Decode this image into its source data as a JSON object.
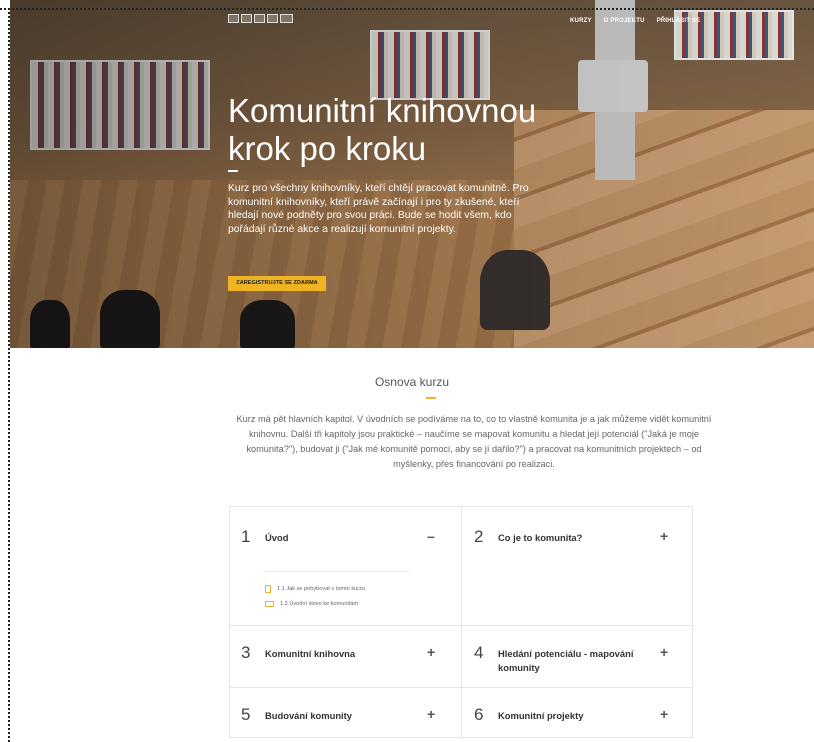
{
  "nav": {
    "items": [
      {
        "label": "KURZY"
      },
      {
        "label": "O PROJEKTU"
      },
      {
        "label": "PŘIHLÁSIT SE"
      }
    ]
  },
  "hero": {
    "title": "Komunitní knihovnou krok po kroku",
    "text": "Kurz pro všechny knihovníky, kteří chtějí pracovat komunitně. Pro komunitní knihovníky, kteří právě začínají i pro ty zkušené, kteří hledají nové podněty pro svou práci. Bude se hodit všem, kdo pořádají různé akce a realizují komunitní projekty.",
    "cta_label": "ZAREGISTRUJTE SE ZDARMA"
  },
  "section": {
    "title": "Osnova kurzu",
    "description": "Kurz má pět hlavních kapitol. V úvodních se podíváme na to, co to vlastně komunita je a jak můžeme vidět komunitní knihovnu. Další tři kapitoly jsou praktické – naučíme se mapovat komunitu a hledat její potenciál (\"Jaká je moje komunita?\"), budovat ji (\"Jak mé komunitě pomoci, aby se jí dařilo?\") a pracovat na komunitních projektech – od myšlenky, přes financování po realizaci."
  },
  "modules": [
    {
      "number": "1",
      "title": "Úvod",
      "toggle": "–",
      "expanded": true,
      "lessons": [
        {
          "icon": "document-icon",
          "label": "1.1 Jak se pohybovat v tomto kurzu"
        },
        {
          "icon": "video-icon",
          "label": "1.2 Úvodní slovo ke komunitám"
        }
      ]
    },
    {
      "number": "2",
      "title": "Co je to komunita?",
      "toggle": "+",
      "expanded": false
    },
    {
      "number": "3",
      "title": "Komunitní knihovna",
      "toggle": "+",
      "expanded": false
    },
    {
      "number": "4",
      "title": "Hledání potenciálu - mapování komunity",
      "toggle": "+",
      "expanded": false
    },
    {
      "number": "5",
      "title": "Budování komunity",
      "toggle": "+",
      "expanded": false
    },
    {
      "number": "6",
      "title": "Komunitní projekty",
      "toggle": "+",
      "expanded": false
    }
  ],
  "colors": {
    "accent": "#f0b321"
  }
}
